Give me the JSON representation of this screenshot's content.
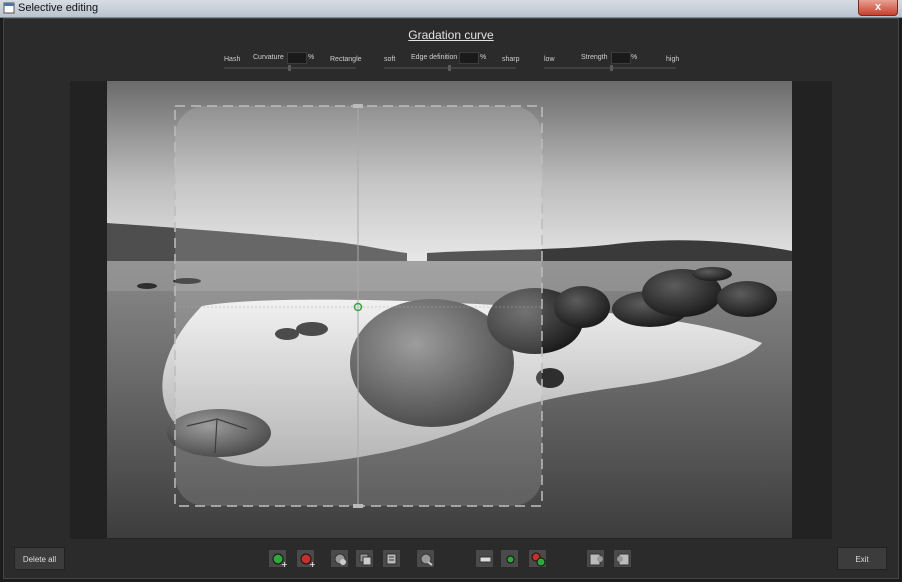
{
  "window": {
    "title": "Selective editing",
    "close_glyph": "x"
  },
  "heading": "Gradation curve",
  "controls": {
    "curvature": {
      "label": "Curvature",
      "left": "Hash",
      "right": "Rectangle",
      "unit": "%",
      "value": ""
    },
    "edge": {
      "label": "Edge definition",
      "left": "soft",
      "right": "sharp",
      "unit": "%",
      "value": ""
    },
    "strength": {
      "label": "Strength",
      "left": "low",
      "right": "high",
      "unit": "%",
      "value": ""
    }
  },
  "buttons": {
    "delete_all": "Delete all",
    "exit": "Exit"
  },
  "toolbar_icons": [
    "add-green-point-icon",
    "add-red-point-icon",
    "copy-selection-icon",
    "duplicate-icon",
    "delete-selection-icon",
    "paste-selection-icon",
    "minus-icon",
    "green-dot-icon",
    "multi-point-icon",
    "import-icon",
    "export-icon"
  ],
  "colors": {
    "accent_green": "#2fa83a",
    "accent_red": "#c7302a",
    "background": "#2b2b2b"
  }
}
